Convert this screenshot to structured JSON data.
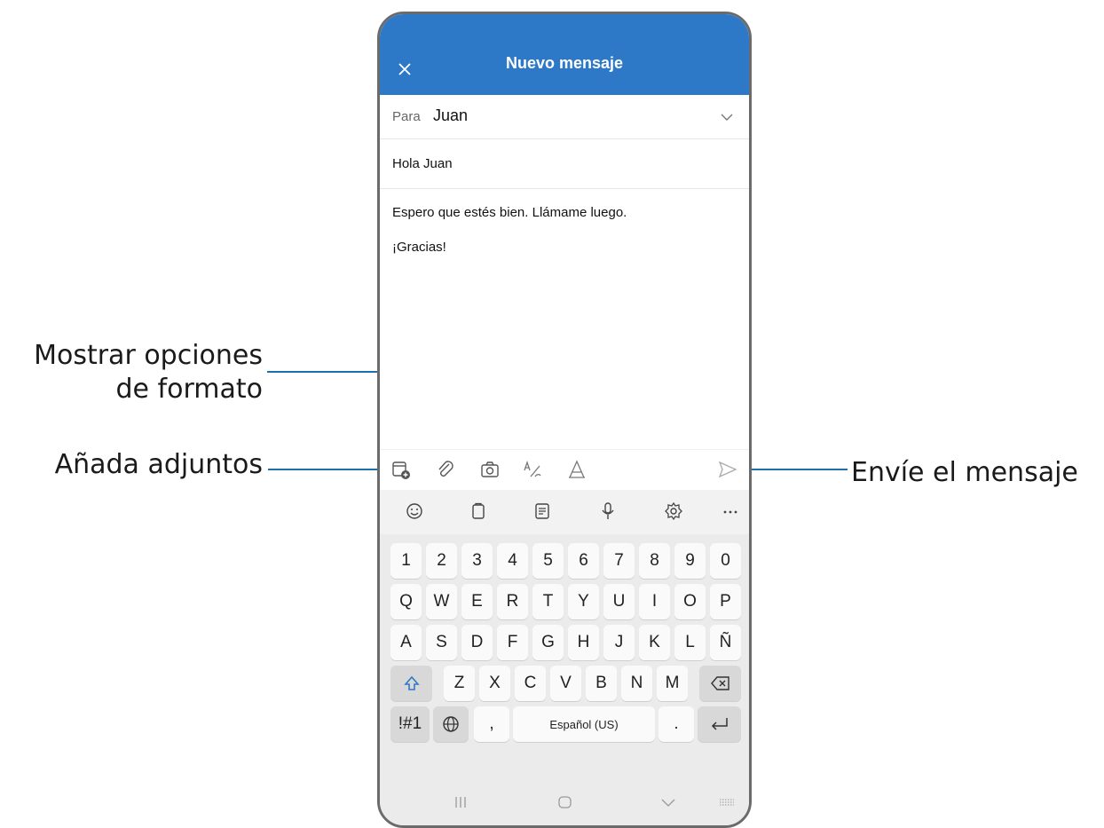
{
  "callouts": {
    "format_line1": "Mostrar opciones",
    "format_line2": "de formato",
    "attachments": "Añada adjuntos",
    "send": "Envíe el mensaje"
  },
  "header": {
    "title": "Nuevo mensaje"
  },
  "recipient": {
    "label": "Para",
    "value": "Juan"
  },
  "subject": "Hola Juan",
  "body": {
    "line1": "Espero que estés bien. Llámame luego.",
    "line2": "¡Gracias!"
  },
  "keyboard": {
    "row_numbers": [
      "1",
      "2",
      "3",
      "4",
      "5",
      "6",
      "7",
      "8",
      "9",
      "0"
    ],
    "row_q": [
      "Q",
      "W",
      "E",
      "R",
      "T",
      "Y",
      "U",
      "I",
      "O",
      "P"
    ],
    "row_a": [
      "A",
      "S",
      "D",
      "F",
      "G",
      "H",
      "J",
      "K",
      "L",
      "Ñ"
    ],
    "row_z": [
      "Z",
      "X",
      "C",
      "V",
      "B",
      "N",
      "M"
    ],
    "symbols": "!#1",
    "comma": ",",
    "space": "Español (US)",
    "period": "."
  },
  "colors": {
    "header_bg": "#2d79c7",
    "callout_line": "#1f6fa8"
  }
}
